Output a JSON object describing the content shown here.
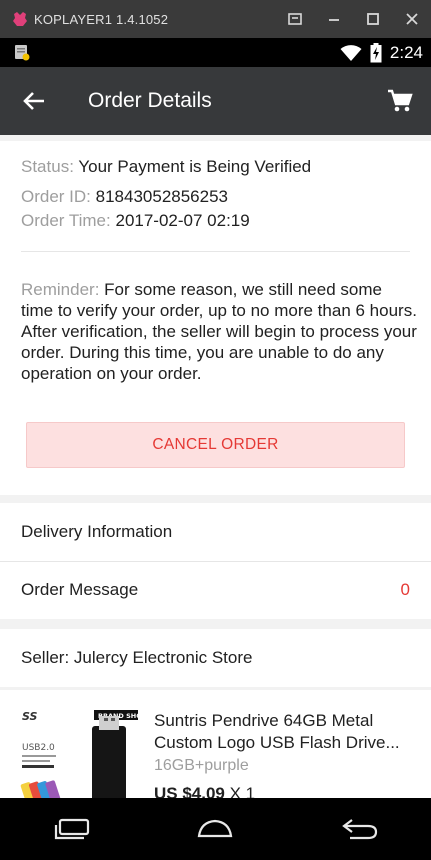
{
  "emulator": {
    "title": "KOPLAYER1 1.4.1052",
    "logo_icon": "koplayer-logo-icon",
    "controls": [
      "window-icon",
      "minimize-icon",
      "maximize-icon",
      "close-icon"
    ]
  },
  "status_bar": {
    "time": "2:24",
    "icons": [
      "notification-icon",
      "wifi-icon",
      "battery-charging-icon"
    ]
  },
  "header": {
    "title": "Order Details",
    "back_icon": "back-arrow-icon",
    "cart_icon": "cart-icon"
  },
  "order": {
    "status_label": "Status:",
    "status_value": "Your Payment is Being Verified",
    "id_label": "Order ID:",
    "id_value": "81843052856253",
    "time_label": "Order Time:",
    "time_value": "2017-02-07 02:19",
    "reminder_label": "Reminder:",
    "reminder_text": "For some reason, we still need some time to verify your order, up to no more than 6 hours. After verification, the seller will begin to process your order. During this time, you are unable to do any operation on your order.",
    "cancel_label": "CANCEL ORDER"
  },
  "delivery": {
    "delivery_label": "Delivery Information",
    "message_label": "Order Message",
    "message_count": "0"
  },
  "seller": {
    "label": "Seller: Julercy Electronic Store"
  },
  "product": {
    "title": "Suntris Pendrive 64GB Metal Custom Logo USB Flash Drive...",
    "variant": "16GB+purple",
    "price": "US $4.09",
    "qty": "X 1",
    "thumb_brand": "BRAND SHOP",
    "thumb_usb": "USB2.0"
  },
  "colors": {
    "accent": "#e53935",
    "header_bg": "#37393b",
    "cancel_bg": "#fde0e0"
  }
}
